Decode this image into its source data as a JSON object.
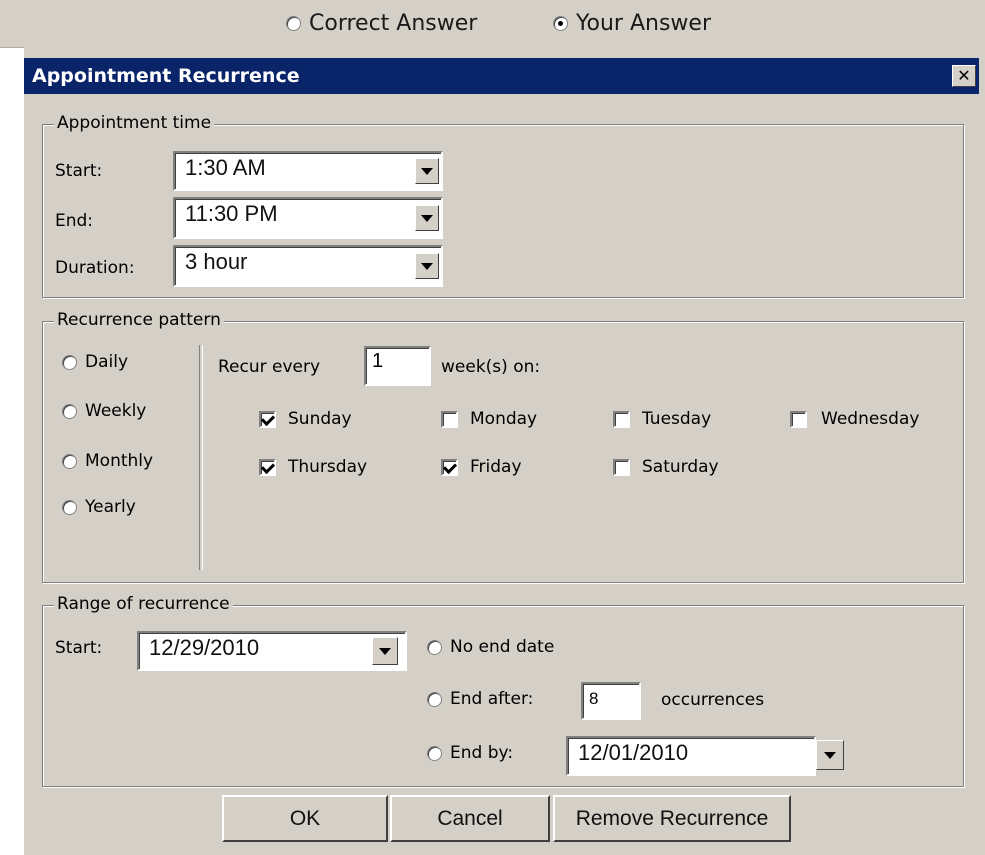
{
  "answer_toggle": {
    "correct_label": "Correct Answer",
    "your_label": "Your Answer",
    "selected": "your"
  },
  "dialog": {
    "title": "Appointment Recurrence",
    "close_label": "✕"
  },
  "appointment_time": {
    "legend": "Appointment time",
    "start_label": "Start:",
    "start_value": "1:30 AM",
    "end_label": "End:",
    "end_value": "11:30 PM",
    "duration_label": "Duration:",
    "duration_value": "3 hour"
  },
  "recurrence_pattern": {
    "legend": "Recurrence pattern",
    "frequencies": [
      "Daily",
      "Weekly",
      "Monthly",
      "Yearly"
    ],
    "recur_every_label": "Recur every",
    "recur_every_value": "1",
    "weeks_on_label": "week(s) on:",
    "days": [
      {
        "label": "Sunday",
        "checked": true
      },
      {
        "label": "Monday",
        "checked": false
      },
      {
        "label": "Tuesday",
        "checked": false
      },
      {
        "label": "Wednesday",
        "checked": false
      },
      {
        "label": "Thursday",
        "checked": true
      },
      {
        "label": "Friday",
        "checked": true
      },
      {
        "label": "Saturday",
        "checked": false
      }
    ]
  },
  "range_of_recurrence": {
    "legend": "Range of recurrence",
    "start_label": "Start:",
    "start_value": "12/29/2010",
    "no_end_label": "No end date",
    "end_after_label": "End after:",
    "end_after_value": "8",
    "occurrences_label": "occurrences",
    "end_by_label": "End by:",
    "end_by_value": "12/01/2010"
  },
  "buttons": {
    "ok": "OK",
    "cancel": "Cancel",
    "remove": "Remove Recurrence"
  },
  "colors": {
    "titlebar": "#0a246a",
    "dialog_face": "#d4d0c8"
  }
}
